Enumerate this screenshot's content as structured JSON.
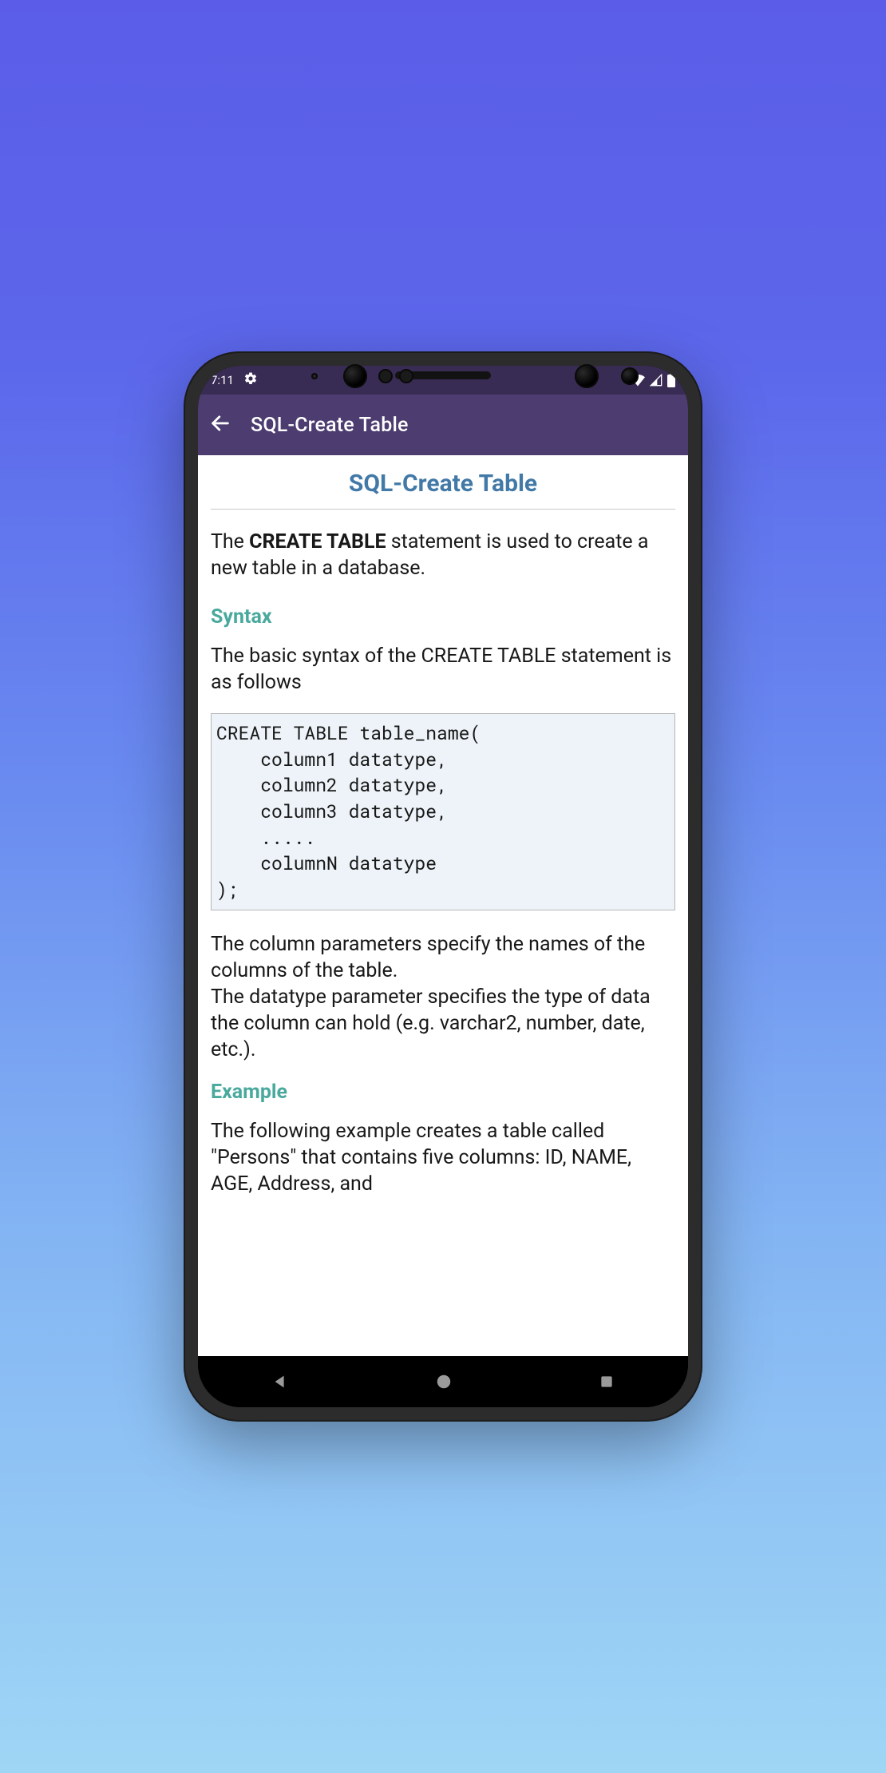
{
  "status": {
    "time": "7:11"
  },
  "appbar": {
    "title": "SQL-Create Table"
  },
  "page": {
    "title": "SQL-Create Table",
    "intro_prefix": "The ",
    "intro_keyword": "CREATE TABLE",
    "intro_suffix": " statement is used to create a new table in a database.",
    "syntax_heading": "Syntax",
    "syntax_para": "The basic syntax of the CREATE TABLE statement is as follows",
    "syntax_code": "CREATE TABLE table_name(\n    column1 datatype,\n    column2 datatype,\n    column3 datatype,\n    .....\n    columnN datatype\n);",
    "desc_para": "The column parameters specify the names of the columns of the table.\nThe datatype parameter specifies the type of data the column can hold (e.g. varchar2, number, date, etc.).",
    "example_heading": "Example",
    "example_para": "The following example creates a table called \"Persons\" that contains five columns: ID, NAME, AGE, Address, and"
  }
}
